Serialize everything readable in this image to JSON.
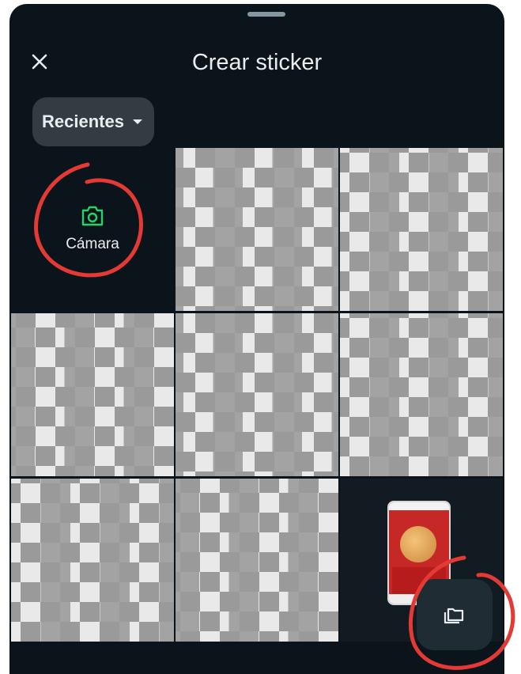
{
  "header": {
    "title": "Crear sticker",
    "close_icon": "close-icon"
  },
  "filter": {
    "label": "Recientes",
    "icon": "caret-down-icon"
  },
  "grid": {
    "camera_label": "Cámara",
    "camera_icon": "camera-icon"
  },
  "fab": {
    "icon": "folder-icon"
  },
  "colors": {
    "background": "#0b141a",
    "text": "#e9edef",
    "chip": "#323c42",
    "camera_icon": "#25d366",
    "annotation": "#e53935"
  }
}
